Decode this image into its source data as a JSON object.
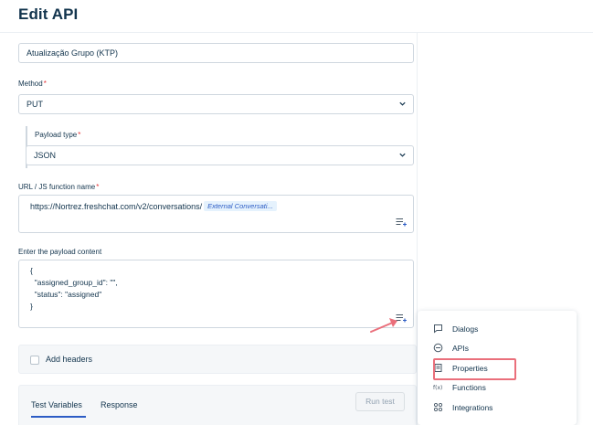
{
  "header": {
    "title": "Edit API"
  },
  "form": {
    "name_value": "Atualização Grupo (KTP)",
    "method": {
      "label": "Method",
      "required": "*",
      "value": "PUT"
    },
    "payload_type": {
      "label": "Payload type",
      "required": "*",
      "value": "JSON"
    },
    "url": {
      "label": "URL / JS function name",
      "required": "*",
      "value": "https://Nortrez.freshchat.com/v2/conversations/",
      "variable_pill": "External Conversati..."
    },
    "payload": {
      "label": "Enter the payload content",
      "lines": [
        "{",
        "  \"assigned_group_id\": \"\",",
        "  \"status\": \"assigned\"",
        "}"
      ]
    },
    "headers": {
      "label": "Add headers",
      "checked": false
    }
  },
  "test": {
    "tabs": [
      {
        "label": "Test Variables",
        "active": true
      },
      {
        "label": "Response",
        "active": false
      }
    ],
    "run_label": "Run test"
  },
  "insert_menu": {
    "items": [
      {
        "label": "Dialogs",
        "icon": "chat-bubble-icon"
      },
      {
        "label": "APIs",
        "icon": "api-icon"
      },
      {
        "label": "Properties",
        "icon": "document-icon",
        "highlighted": true
      },
      {
        "label": "Functions",
        "icon": "function-icon"
      },
      {
        "label": "Integrations",
        "icon": "integrations-icon"
      }
    ]
  },
  "colors": {
    "accent": "#2c5cc5",
    "highlight": "#ea6f7b",
    "required": "#e43538",
    "text": "#12344d"
  }
}
